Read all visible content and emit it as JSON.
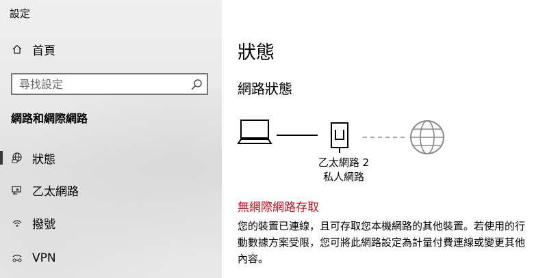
{
  "window": {
    "title": "設定"
  },
  "sidebar": {
    "home_label": "首頁",
    "search": {
      "placeholder": "尋找設定"
    },
    "section_title": "網路和網際網路",
    "items": [
      {
        "label": "狀態",
        "icon": "status-globe-icon",
        "selected": true
      },
      {
        "label": "乙太網路",
        "icon": "ethernet-icon",
        "selected": false
      },
      {
        "label": "撥號",
        "icon": "dialup-icon",
        "selected": false
      },
      {
        "label": "VPN",
        "icon": "vpn-icon",
        "selected": false
      }
    ]
  },
  "main": {
    "title": "狀態",
    "network_status_title": "網路狀態",
    "network": {
      "name": "乙太網路 2",
      "type": "私人網路"
    },
    "warning": "無網際網路存取",
    "description": "您的裝置已連線，且可存取您本機網路的其他裝置。若使用的行動數據方案受限，您可將此網路設定為計量付費連線或變更其他內容。"
  },
  "colors": {
    "warning": "#c50f1f",
    "selection_bar": "#3a3a3a",
    "sidebar_bg": "#e9e9e9"
  }
}
